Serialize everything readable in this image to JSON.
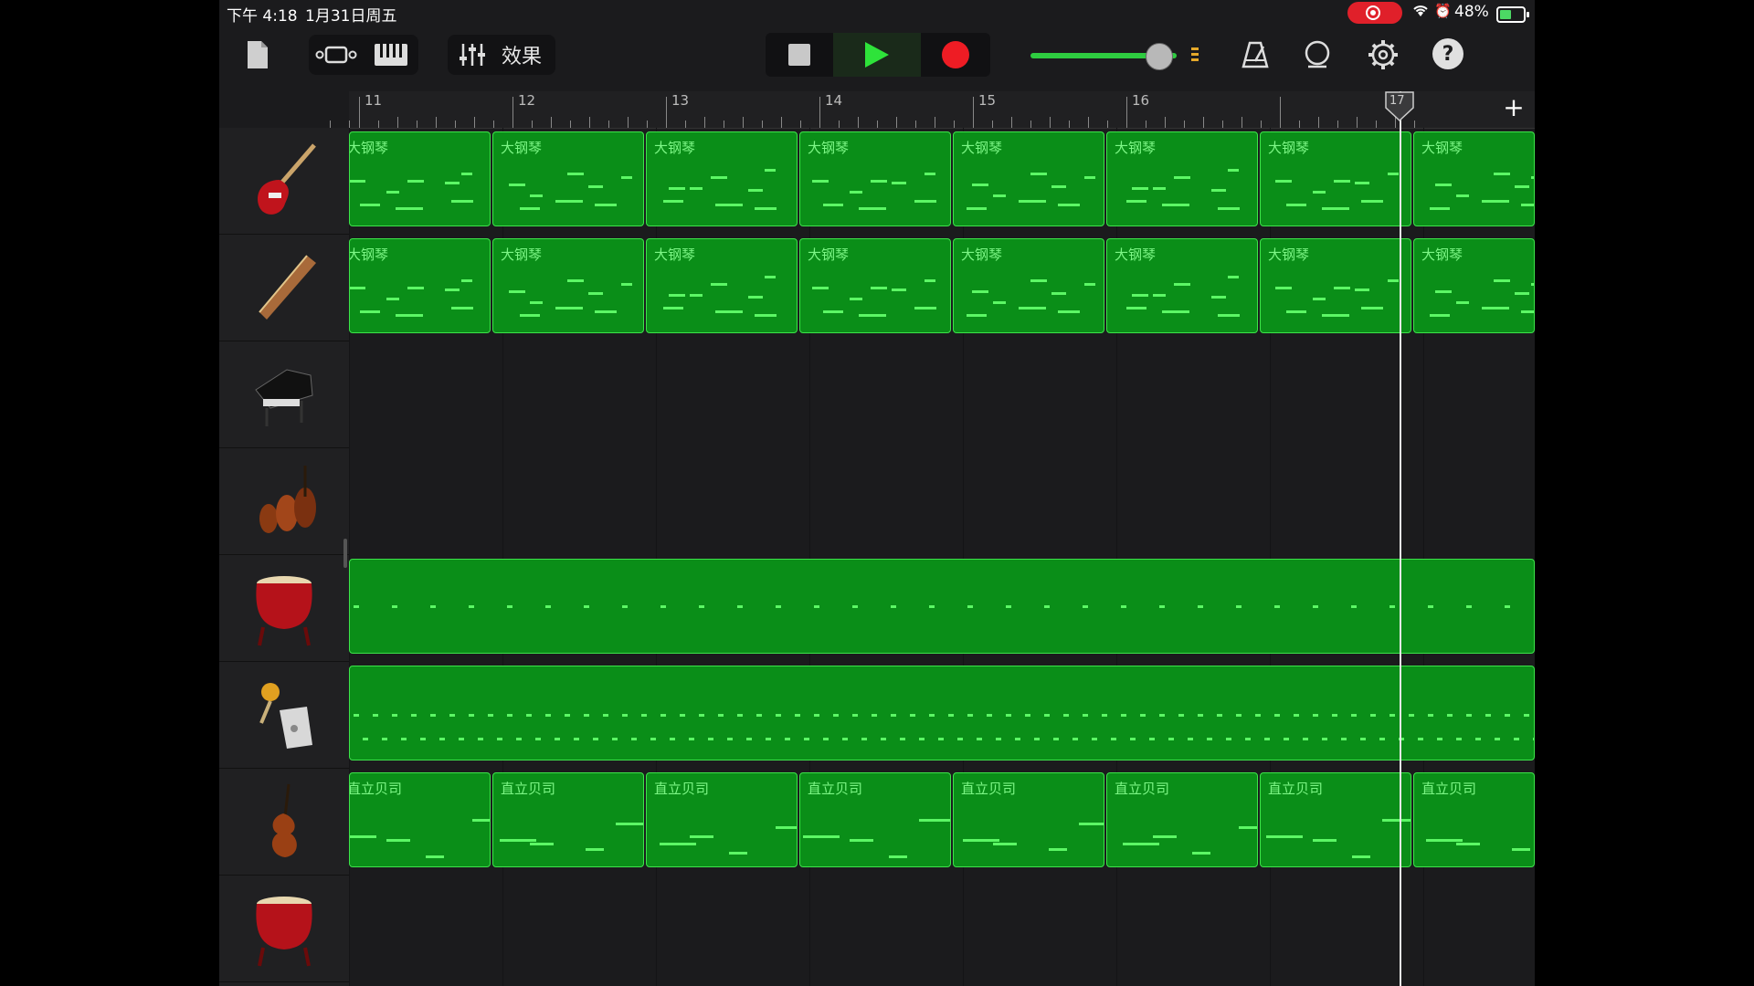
{
  "status_bar": {
    "time": "下午 4:18",
    "date": "1月31日周五",
    "battery": "48%"
  },
  "toolbar": {
    "effects_label": "效果",
    "volume_level": 0.78
  },
  "ruler": {
    "bars": [
      "11",
      "12",
      "13",
      "14",
      "15",
      "16",
      "17"
    ],
    "add_label": "+"
  },
  "playhead_bar": "17",
  "tracks": [
    {
      "icon": "electric-bass-icon",
      "region_label": "大钢琴",
      "type": "melodic"
    },
    {
      "icon": "guzheng-icon",
      "region_label": "大钢琴",
      "type": "melodic"
    },
    {
      "icon": "grand-piano-icon",
      "region_label": "",
      "type": "empty"
    },
    {
      "icon": "string-ensemble-icon",
      "region_label": "",
      "type": "empty"
    },
    {
      "icon": "chinese-drum-icon",
      "region_label": "",
      "type": "drum"
    },
    {
      "icon": "percussion-icon",
      "region_label": "",
      "type": "percussion"
    },
    {
      "icon": "upright-bass-icon",
      "region_label": "直立贝司",
      "type": "bass"
    },
    {
      "icon": "chinese-drum-icon",
      "region_label": "",
      "type": "empty"
    }
  ],
  "colors": {
    "region_fill": "#0a8e18",
    "region_border": "#3de34a",
    "note": "#5cf765",
    "play": "#2ee33a",
    "record": "#ee1c24"
  }
}
